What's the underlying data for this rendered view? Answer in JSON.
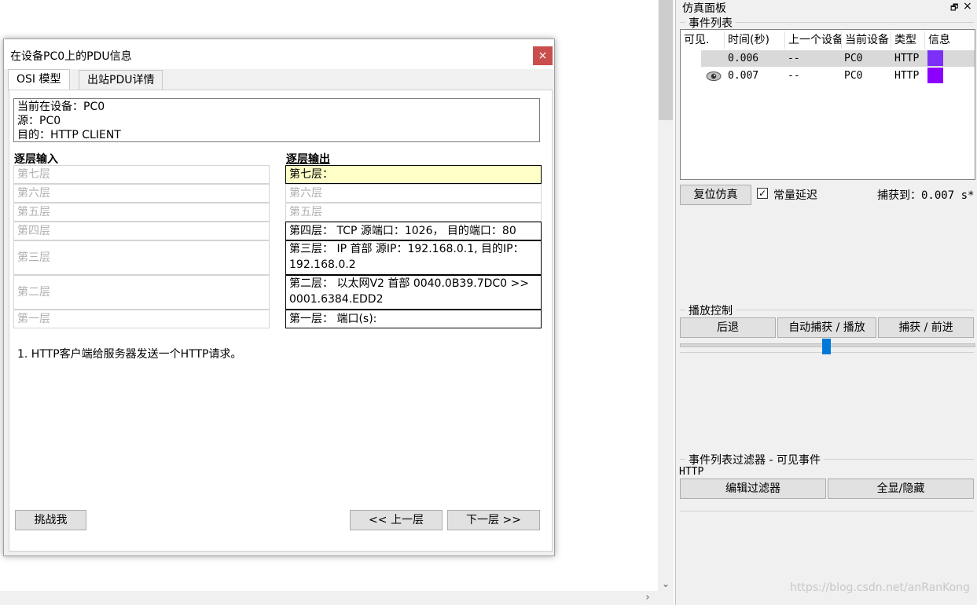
{
  "dialog": {
    "title": "在设备PC0上的PDU信息",
    "close_glyph": "×",
    "tabs": [
      {
        "label": "OSI 模型",
        "active": true
      },
      {
        "label": "出站PDU详情",
        "active": false
      }
    ],
    "info": {
      "current_device": "当前在设备：PC0",
      "source": "源：PC0",
      "destination": "目的：HTTP CLIENT"
    },
    "in_header": "逐层输入",
    "out_header": "逐层输出",
    "in_layers": [
      "第七层",
      "第六层",
      "第五层",
      "第四层",
      "第三层",
      "第二层",
      "第一层"
    ],
    "out_layers": [
      "第七层：",
      "第六层",
      "第五层",
      "第四层： TCP 源端口：1026， 目的端口：80",
      "第三层： IP 首部 源IP：192.168.0.1, 目的IP：192.168.0.2",
      "第二层： 以太网V2 首部 0040.0B39.7DC0 >> 0001.6384.EDD2",
      "第一层： 端口(s):"
    ],
    "description": "1. HTTP客户端给服务器发送一个HTTP请求。",
    "challenge_label": "挑战我",
    "prev_label": "<< 上一层",
    "next_label": "下一层 >>"
  },
  "sim": {
    "title": "仿真面板",
    "restore_glyph": "🗗",
    "close_glyph": "×",
    "event_list_label": "事件列表",
    "columns": [
      "可见.",
      "时间(秒)",
      "上一个设备",
      "当前设备",
      "类型",
      "信息"
    ],
    "events": [
      {
        "time": "0.006",
        "prev": "--",
        "current": "PC0",
        "type": "HTTP",
        "color": "#7b2ff7",
        "selected": true
      },
      {
        "time": "0.007",
        "prev": "--",
        "current": "PC0",
        "type": "HTTP",
        "color": "#8b00ff",
        "selected": false
      }
    ],
    "reset_label": "复位仿真",
    "const_delay_label": "常量延迟",
    "const_delay_checked": "✓",
    "captured_label": "捕获到：0.007 s*",
    "playback_label": "播放控制",
    "back_label": "后退",
    "auto_label": "自动捕获 / 播放",
    "step_label": "捕获 / 前进",
    "slider_position": 0.5,
    "filter_label": "事件列表过滤器 - 可见事件",
    "filter_value": "HTTP",
    "edit_filter_label": "编辑过滤器",
    "show_all_label": "全显/隐藏",
    "watermark": "https://blog.csdn.net/anRanKong"
  },
  "colors": {
    "close_button": "#c94f4f",
    "highlight_layer": "#ffffc8",
    "slider_thumb": "#0078d7"
  }
}
